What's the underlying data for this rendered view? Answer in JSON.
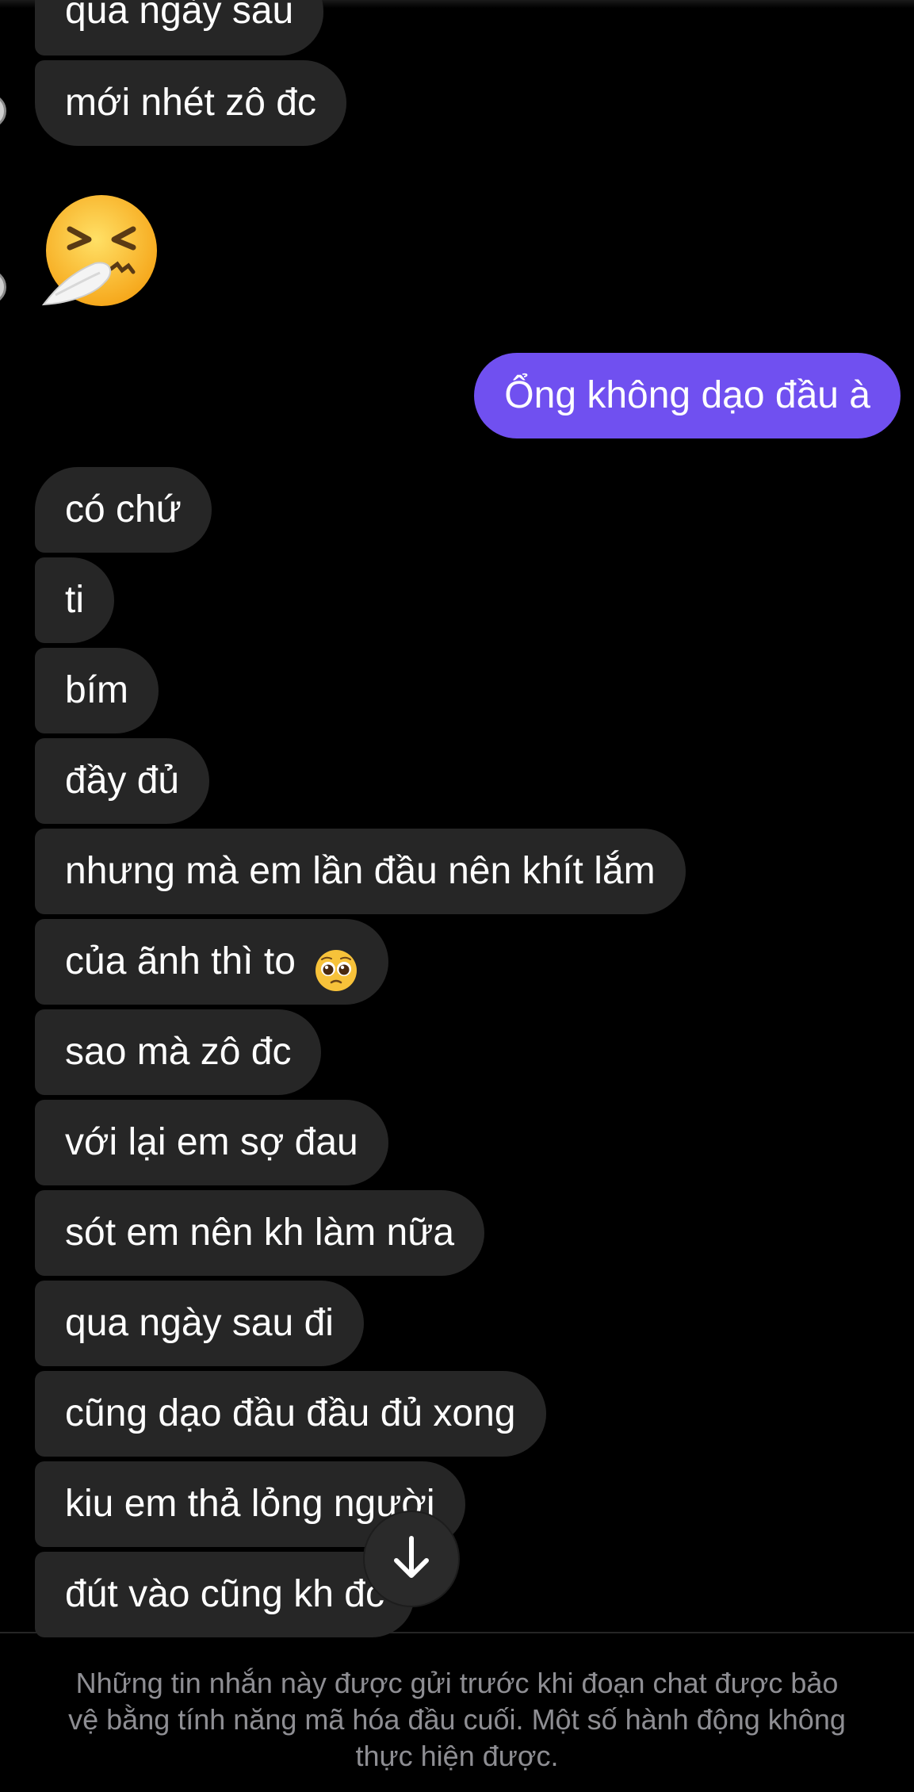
{
  "messages": {
    "m0": "qua ngày sau",
    "m1": "mới nhét zô đc",
    "sent": "Ổng không dạo đầu à",
    "r1": "có chứ",
    "r2": "ti",
    "r3": "bím",
    "r4": "đầy đủ",
    "r5": "nhưng mà em lần đầu nên khít lắm",
    "r6": "của ãnh thì to",
    "r7": "sao mà zô đc",
    "r8": "với lại em sợ đau",
    "r9": "sót em nên kh làm nữa",
    "r10": "qua ngày sau đi",
    "r11": "cũng dạo đầu đầu đủ xong",
    "r12": "kiu em thả lỏng người",
    "r13": "đút vào cũng kh đc"
  },
  "emojis": {
    "sneezing": "sneezing-face-emoji",
    "pleading": "pleading-face-emoji"
  },
  "scroll_button_icon": "arrow-down-icon",
  "footer": {
    "line1": "Những tin nhắn này được gửi trước khi đoạn chat được bảo",
    "line2": "vệ bằng tính năng mã hóa đầu cuối. Một số hành động không",
    "line3": "thực hiện được."
  },
  "colors": {
    "background": "#000000",
    "received_bubble": "#262626",
    "sent_bubble": "#7050f0",
    "footer_text": "#8e8e93"
  }
}
